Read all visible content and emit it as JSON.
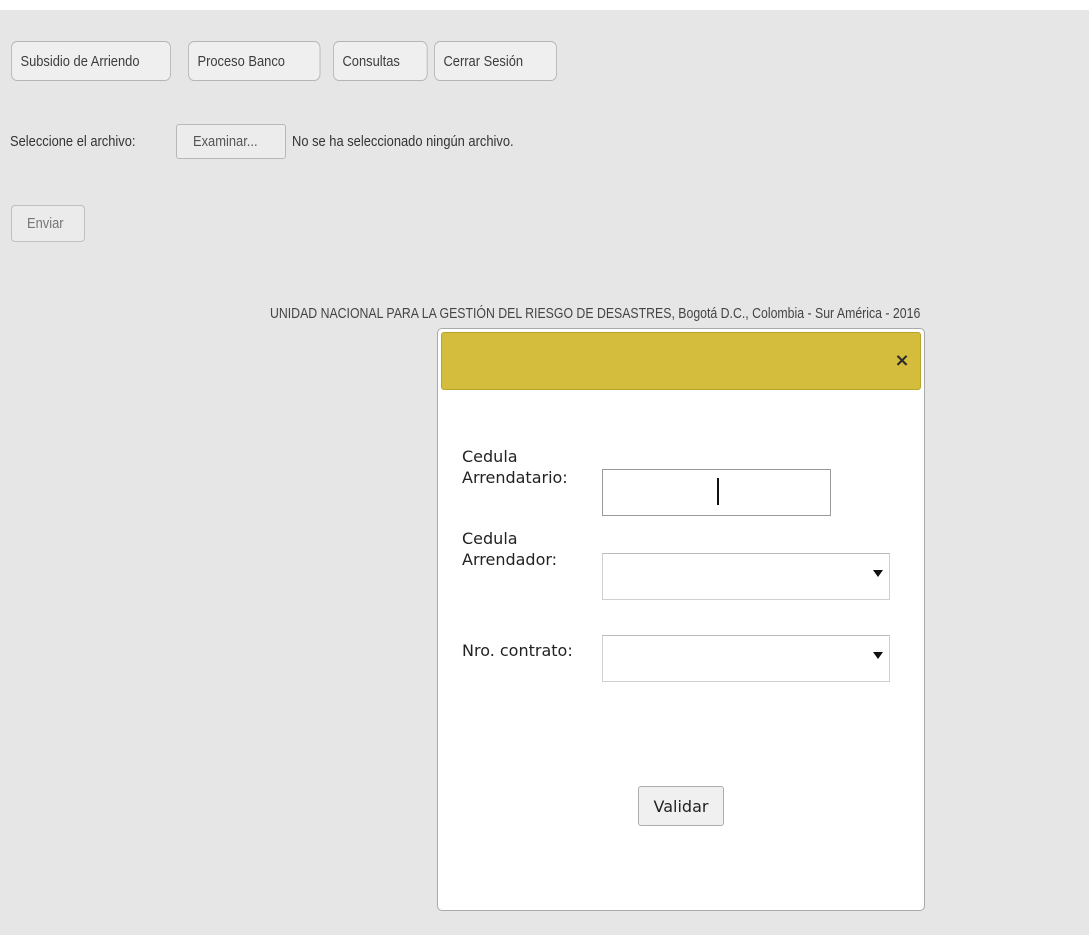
{
  "nav": {
    "items": [
      {
        "label": "Subsidio de Arriendo"
      },
      {
        "label": "Proceso Banco"
      },
      {
        "label": "Consultas"
      },
      {
        "label": "Cerrar Sesión"
      }
    ]
  },
  "upload": {
    "label": "Seleccione el archivo:",
    "browse_label": "Examinar...",
    "status": "No se ha seleccionado ningún archivo.",
    "submit_label": "Enviar"
  },
  "footer": {
    "text": "UNIDAD NACIONAL PARA LA GESTIÓN DEL RIESGO DE DESASTRES, Bogotá D.C., Colombia - Sur América - 2016"
  },
  "modal": {
    "header_color": "#d4bd3c",
    "close_icon": "×",
    "fields": {
      "arrendatario": {
        "label_line1": "Cedula",
        "label_line2": "Arrendatario:",
        "value": ""
      },
      "arrendador": {
        "label_line1": "Cedula",
        "label_line2": "Arrendador:",
        "selected": ""
      },
      "contrato": {
        "label": "Nro. contrato:",
        "selected": ""
      }
    },
    "validate_label": "Validar"
  }
}
